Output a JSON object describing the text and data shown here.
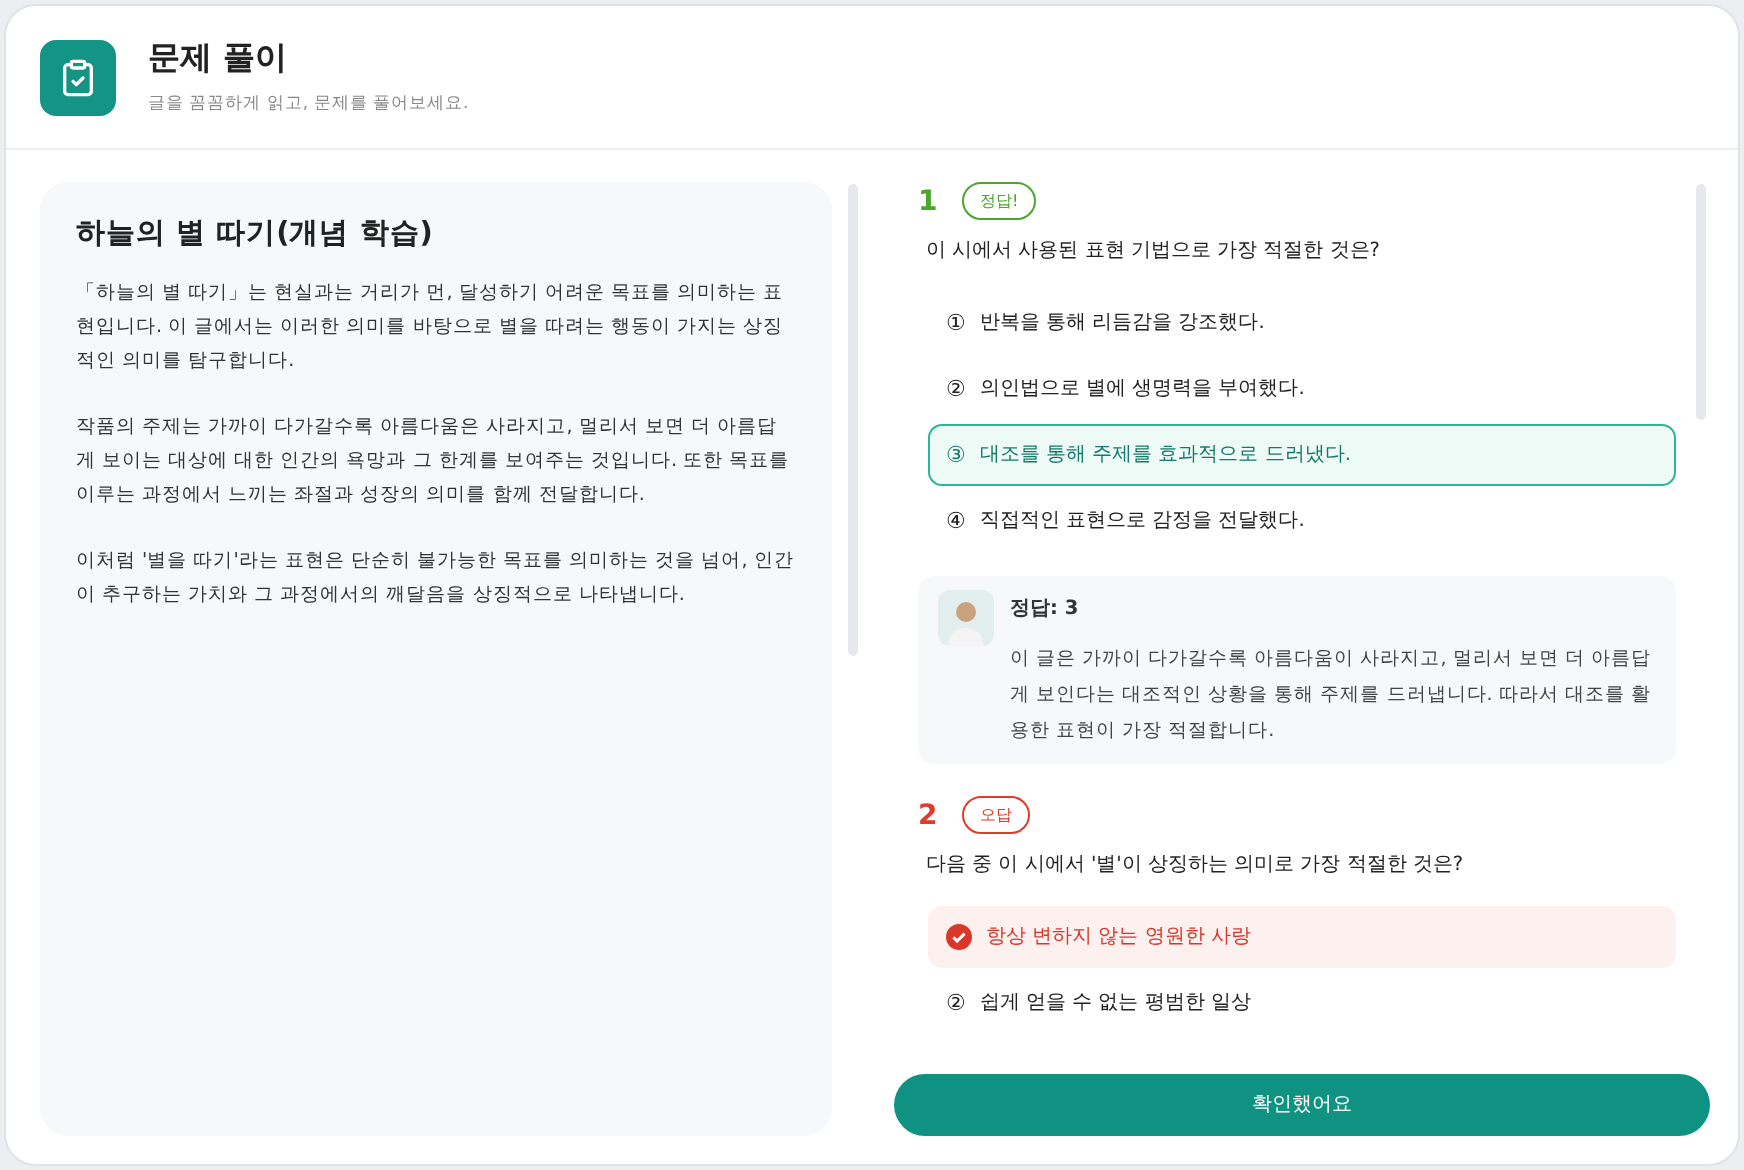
{
  "header": {
    "title": "문제 풀이",
    "subtitle": "글을 꼼꼼하게 읽고, 문제를 풀어보세요."
  },
  "passage": {
    "title": "하늘의 별 따기(개념 학습)",
    "paragraphs": [
      "「하늘의 별 따기」는 현실과는 거리가 먼, 달성하기 어려운 목표를 의미하는 표현입니다. 이 글에서는 이러한 의미를 바탕으로 별을 따려는 행동이 가지는 상징적인 의미를 탐구합니다.",
      "작품의 주제는 가까이 다가갈수록 아름다움은 사라지고, 멀리서 보면 더 아름답게 보이는 대상에 대한 인간의 욕망과 그 한계를 보여주는 것입니다. 또한 목표를 이루는 과정에서 느끼는 좌절과 성장의 의미를 함께 전달합니다.",
      "이처럼 '별을 따기'라는 표현은 단순히 불가능한 목표를 의미하는 것을 넘어, 인간이 추구하는 가치와 그 과정에서의 깨달음을 상징적으로 나타냅니다."
    ]
  },
  "questions": [
    {
      "number": "1",
      "correct": true,
      "badge": "정답!",
      "prompt": "이 시에서 사용된 표현 기법으로 가장 적절한 것은?",
      "options": [
        {
          "marker": "①",
          "text": "반복을 통해 리듬감을 강조했다.",
          "selected": false
        },
        {
          "marker": "②",
          "text": "의인법으로 별에 생명력을 부여했다.",
          "selected": false
        },
        {
          "marker": "③",
          "text": "대조를 통해 주제를 효과적으로 드러냈다.",
          "selected": true
        },
        {
          "marker": "④",
          "text": "직접적인 표현으로 감정을 전달했다.",
          "selected": false
        }
      ],
      "explanation": {
        "answer": "정답: 3",
        "text": "이 글은 가까이 다가갈수록 아름다움이 사라지고, 멀리서 보면 더 아름답게 보인다는 대조적인 상황을 통해 주제를 드러냅니다. 따라서 대조를 활용한 표현이 가장 적절합니다."
      }
    },
    {
      "number": "2",
      "correct": false,
      "badge": "오답",
      "prompt": "다음 중 이 시에서 '별'이 상징하는 의미로 가장 적절한 것은?",
      "options": [
        {
          "text": "항상 변하지 않는 영원한 사랑",
          "selected": true
        },
        {
          "marker": "②",
          "text": "쉽게 얻을 수 없는 평범한 일상",
          "selected": false
        }
      ]
    }
  ],
  "confirm_button": "확인했어요"
}
